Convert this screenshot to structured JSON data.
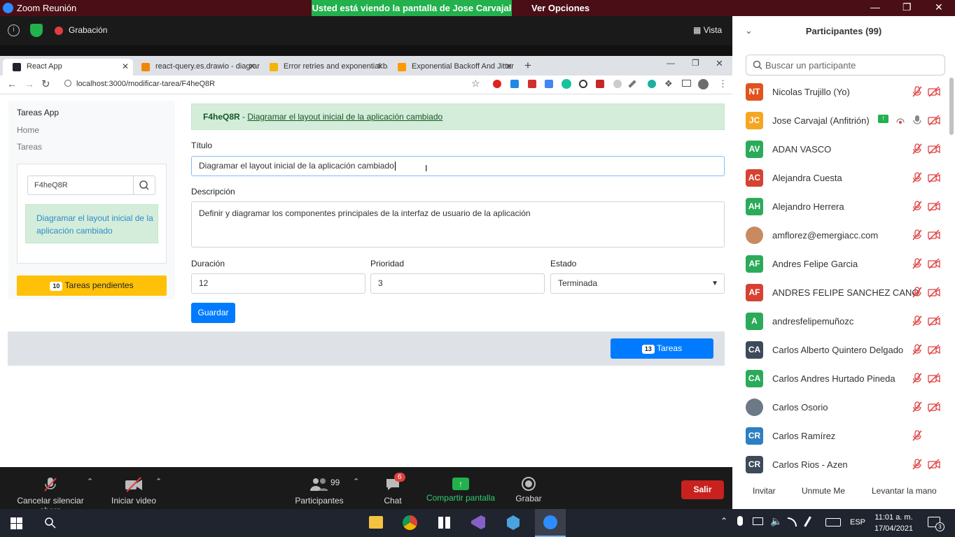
{
  "zoom": {
    "window_title": "Zoom Reunión",
    "banner": "Usted está viendo la pantalla de Jose Carvajal",
    "view_options": "Ver Opciones",
    "recording": "Grabación",
    "view": "Vista",
    "toolbar": {
      "mute": "Cancelar silenciar ahora",
      "video": "Iniciar video",
      "participants": "Participantes",
      "participants_count": "99",
      "chat": "Chat",
      "chat_badge": "6",
      "share": "Compartir pantalla",
      "record": "Grabar",
      "leave": "Salir"
    }
  },
  "browser": {
    "tabs": [
      {
        "title": "React App",
        "fav_color": "#20232a"
      },
      {
        "title": "react-query.es.drawio - diagram",
        "fav_color": "#f08705"
      },
      {
        "title": "Error retries and exponential bac",
        "fav_color": "#f4b400"
      },
      {
        "title": "Exponential Backoff And Jitter | A",
        "fav_color": "#ff9900"
      }
    ],
    "url": "localhost:3000/modificar-tarea/F4heQ8R"
  },
  "app": {
    "brand": "Tareas App",
    "nav": [
      "Home",
      "Tareas"
    ],
    "search_value": "F4heQ8R",
    "result": "Diagramar el layout inicial de la aplicación cambiado",
    "pending_count": "10",
    "pending_label": "Tareas pendientes",
    "alert_id": "F4heQ8R",
    "alert_sep": " - ",
    "alert_link": "Diagramar el layout inicial de la aplicación cambiado",
    "form": {
      "title_label": "Título",
      "title_value": "Diagramar el layout inicial de la aplicación cambiado",
      "desc_label": "Descripción",
      "desc_value": "Definir y diagramar los componentes principales de la interfaz de usuario de la aplicación",
      "duration_label": "Duración",
      "duration_value": "12",
      "priority_label": "Prioridad",
      "priority_value": "3",
      "status_label": "Estado",
      "status_value": "Terminada",
      "save": "Guardar"
    },
    "tasks_count": "13",
    "tasks_label": "Tareas"
  },
  "participants": {
    "title": "Participantes (99)",
    "search_placeholder": "Buscar un participante",
    "list": [
      {
        "initials": "NT",
        "name": "Nicolas Trujillo (Yo)",
        "color": "#e0531f"
      },
      {
        "initials": "JC",
        "name": "Jose Carvajal (Anfitrión)",
        "color": "#f5a623"
      },
      {
        "initials": "AV",
        "name": "ADAN VASCO",
        "color": "#2bab5a"
      },
      {
        "initials": "AC",
        "name": "Alejandra Cuesta",
        "color": "#d64232"
      },
      {
        "initials": "AH",
        "name": "Alejandro Herrera",
        "color": "#2bab5a"
      },
      {
        "initials": "",
        "name": "amflorez@emergiacc.com",
        "color": "#c98a5f"
      },
      {
        "initials": "AF",
        "name": "Andres Felipe Garcia",
        "color": "#2bab5a"
      },
      {
        "initials": "AF",
        "name": "ANDRES FELIPE SANCHEZ CANO",
        "color": "#d64232"
      },
      {
        "initials": "A",
        "name": "andresfelipemuñozc",
        "color": "#2bab5a"
      },
      {
        "initials": "CA",
        "name": "Carlos Alberto Quintero Delgado",
        "color": "#3c4a5a"
      },
      {
        "initials": "CA",
        "name": "Carlos Andres Hurtado Pineda",
        "color": "#2bab5a"
      },
      {
        "initials": "",
        "name": "Carlos Osorio",
        "color": "#6b7a86"
      },
      {
        "initials": "CR",
        "name": "Carlos Ramírez",
        "color": "#2d7fc1"
      },
      {
        "initials": "CR",
        "name": "Carlos Rios - Azen",
        "color": "#3c4a5a"
      }
    ],
    "invite": "Invitar",
    "unmute": "Unmute Me",
    "raise_hand": "Levantar la mano"
  },
  "taskbar": {
    "lang": "ESP",
    "time": "11:01 a. m.",
    "date": "17/04/2021",
    "notif": "3"
  }
}
